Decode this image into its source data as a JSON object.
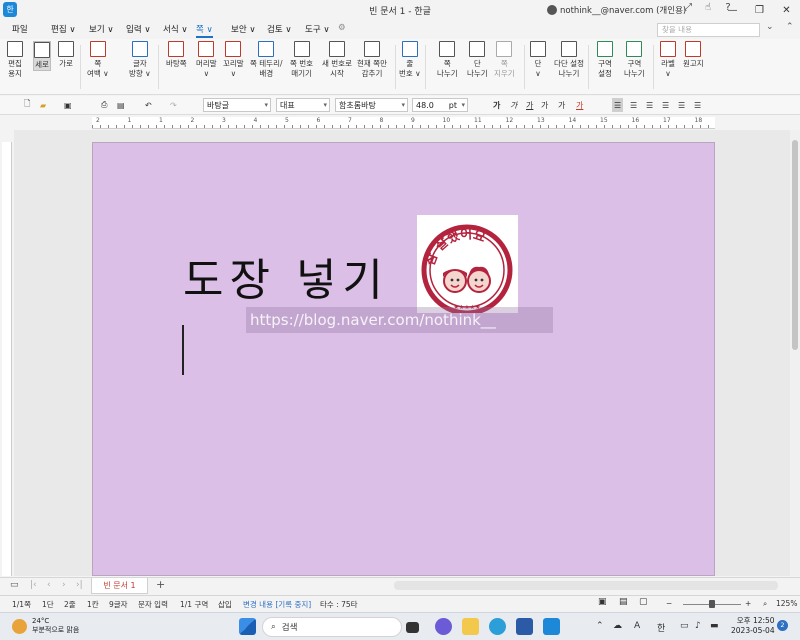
{
  "titlebar": {
    "doc_title": "빈 문서 1 - 한글",
    "account": "nothink__@naver.com (개인용)",
    "app_logo": "한"
  },
  "menu": {
    "items": [
      "파일",
      "편집 ∨",
      "보기 ∨",
      "입력 ∨",
      "서식 ∨",
      "쪽 ∨",
      "보안 ∨",
      "검토 ∨",
      "도구 ∨"
    ],
    "active": "쪽 ∨",
    "search_placeholder": "찾을 내용"
  },
  "ribbon": {
    "buttons": [
      {
        "label": "편집\n용지",
        "icon": "page-setup-icon"
      },
      {
        "label": "세로",
        "icon": "portrait-icon",
        "selected": true
      },
      {
        "label": "가로",
        "icon": "landscape-icon"
      },
      {
        "label": "쪽\n여백 ∨",
        "icon": "page-margin-icon"
      },
      {
        "label": "글자\n방향 ∨",
        "icon": "text-direction-icon"
      },
      {
        "label": "바탕쪽",
        "icon": "master-page-icon"
      },
      {
        "label": "머리말\n∨",
        "icon": "header-icon"
      },
      {
        "label": "꼬리말\n∨",
        "icon": "footer-icon"
      },
      {
        "label": "쪽 테두리/\n배경",
        "icon": "page-border-icon"
      },
      {
        "label": "쪽 번호\n매기기",
        "icon": "page-number-icon"
      },
      {
        "label": "새 번호로\n시작",
        "icon": "new-number-icon"
      },
      {
        "label": "현재 쪽만\n감추기",
        "icon": "hide-page-icon"
      },
      {
        "label": "줄\n번호 ∨",
        "icon": "line-number-icon"
      },
      {
        "label": "쪽\n나누기",
        "icon": "page-break-icon"
      },
      {
        "label": "단\n나누기",
        "icon": "column-break-icon"
      },
      {
        "label": "쪽\n지우기",
        "icon": "delete-page-icon",
        "disabled": true
      },
      {
        "label": "단\n∨",
        "icon": "column-icon"
      },
      {
        "label": "다단 설정\n나누기",
        "icon": "multi-column-icon"
      },
      {
        "label": "구역\n설정",
        "icon": "section-setup-icon"
      },
      {
        "label": "구역\n나누기",
        "icon": "section-break-icon"
      },
      {
        "label": "라벨\n∨",
        "icon": "label-icon"
      },
      {
        "label": "원고지",
        "icon": "manuscript-icon"
      }
    ]
  },
  "toolbar2": {
    "style": "바탕글",
    "font_lang": "대표",
    "font": "함초롬바탕",
    "size": "48.0",
    "unit": "pt"
  },
  "ruler": {
    "numbers": [
      "2",
      "1",
      "1",
      "2",
      "3",
      "4",
      "5",
      "6",
      "7",
      "8",
      "9",
      "10",
      "11",
      "12",
      "13",
      "14",
      "15",
      "16",
      "17",
      "18"
    ]
  },
  "document": {
    "heading": "도장 넣기",
    "stamp_text": "참 잘했어요",
    "watermark": "https://blog.naver.com/nothink__"
  },
  "tabs": {
    "doc_tab": "빈 문서 1"
  },
  "status": {
    "page": "1/1쪽",
    "column": "1단",
    "line": "2줄",
    "col": "1칸",
    "chars": "9글자",
    "mode": "문자 입력",
    "section": "1/1 구역",
    "insert": "삽입",
    "track": "변경 내용 [기록 중지]",
    "typing": "타수 : 75타",
    "zoom": "125%",
    "zoom_level": 0.5
  },
  "taskbar": {
    "temperature": "24°C",
    "weather": "부분적으로 맑음",
    "search": "검색",
    "lang": "A",
    "ime": "한",
    "time": "오후 12:50",
    "date": "2023-05-04",
    "notifications": "2"
  },
  "colors": {
    "page_bg": "#dcbfe6",
    "accent": "#1a73c9",
    "stamp": "#b4233d"
  }
}
